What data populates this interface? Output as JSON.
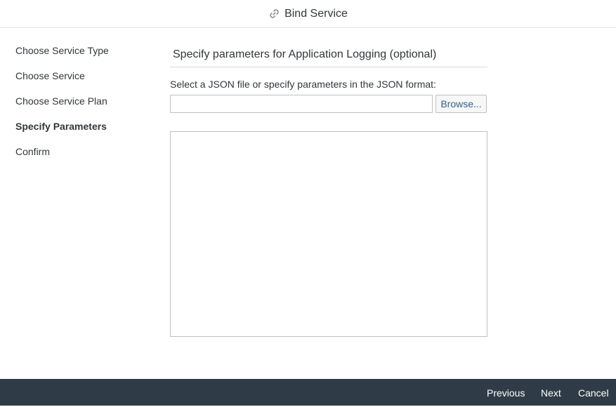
{
  "header": {
    "title": "Bind Service",
    "icon": "link-icon"
  },
  "steps": [
    {
      "label": "Choose Service Type",
      "active": false
    },
    {
      "label": "Choose Service",
      "active": false
    },
    {
      "label": "Choose Service Plan",
      "active": false
    },
    {
      "label": "Specify Parameters",
      "active": true
    },
    {
      "label": "Confirm",
      "active": false
    }
  ],
  "main": {
    "section_title": "Specify parameters for Application Logging (optional)",
    "json_label": "Select a JSON file or specify parameters in the JSON format:",
    "file_input_value": "",
    "browse_label": "Browse...",
    "json_text": ""
  },
  "footer": {
    "previous_label": "Previous",
    "next_label": "Next",
    "cancel_label": "Cancel"
  },
  "colors": {
    "footer_bg": "#2f3c48",
    "link_button": "#346187",
    "text": "#32363a"
  }
}
